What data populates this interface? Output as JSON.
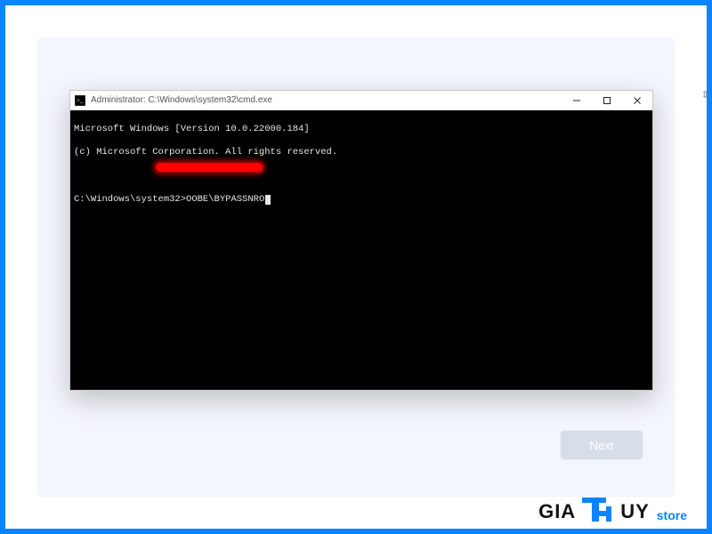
{
  "window": {
    "title": "Administrator: C:\\Windows\\system32\\cmd.exe",
    "minimize_label": "Minimize",
    "maximize_label": "Maximize",
    "close_label": "Close"
  },
  "terminal": {
    "line1": "Microsoft Windows [Version 10.0.22000.184]",
    "line2": "(c) Microsoft Corporation. All rights reserved.",
    "prompt": "C:\\Windows\\system32>",
    "command": "OOBE\\BYPASSNRO"
  },
  "oobe": {
    "next_label": "Next"
  },
  "watermark": {
    "part1": "GIA",
    "part2": "UY",
    "store": "store"
  }
}
